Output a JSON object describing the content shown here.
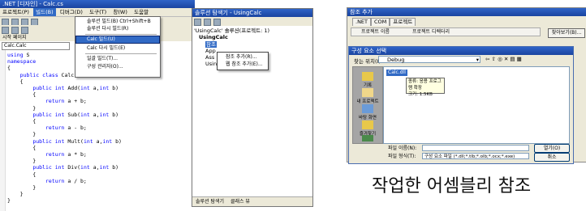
{
  "panel1": {
    "title": ".NET [디자인] - Calc.cs",
    "menu": [
      "프로젝트(P)",
      "빌드(B)",
      "디버그(D)",
      "도구(T)",
      "창(W)",
      "도움말"
    ],
    "selected_menu_index": 1,
    "tab_label": "시작 페이지",
    "combo_value": "Calc.Calc",
    "build_menu": [
      "솔루션 빌드(B)  Ctrl+Shift+B",
      "솔루션 다시 빌드(R)",
      "Calc 빌드(U)",
      "Calc 다시 빌드(E)",
      "일괄 빌드(T)...",
      "구성 관리자(O)..."
    ],
    "selected_build_item": 2,
    "code_lines": [
      "using S",
      "namespace",
      "{",
      "    public class Calc",
      "    {",
      "        public int Add(int a,int b)",
      "        {",
      "            return a + b;",
      "        }",
      "        public int Sub(int a,int b)",
      "        {",
      "            return a - b;",
      "        }",
      "        public int Mult(int a,int b)",
      "        {",
      "            return a * b;",
      "        }",
      "        public int Div(int a,int b)",
      "        {",
      "            return a / b;",
      "        }",
      "    }",
      "}"
    ]
  },
  "panel2": {
    "title": "솔루션 탐색기 - UsingCalc",
    "solution_node": "'UsingCalc' 솔루션(프로젝트: 1)",
    "project_node": "UsingCalc",
    "child_nodes": [
      "참조",
      "App",
      "Ass",
      "UsingCalc.cs"
    ],
    "context_menu": [
      "참조 추가(R)...",
      "웹 참조 추가(E)..."
    ],
    "bottom_tabs": [
      "솔루션 탐색기",
      "클래스 뷰"
    ]
  },
  "panel3": {
    "title": "참조 추가",
    "tabs": [
      ".NET",
      "COM",
      "프로젝트"
    ],
    "columns": [
      "프로젝트 이름",
      "프로젝트 디렉터리"
    ],
    "browse_label": "찾아보기(B)..."
  },
  "panel4": {
    "title": "구성 요소 선택",
    "look_in_label": "찾는 위치(I):",
    "look_in_value": "Debug",
    "places": [
      "기록",
      "내 프로젝트",
      "바탕 화면",
      "즐겨찾기",
      ""
    ],
    "selected_file": "Calc.dll",
    "tooltip_lines": [
      "종류: 응용 프로그램 확장",
      "크기: 1.5KB"
    ],
    "file_name_label": "파일 이름(N):",
    "file_name_value": "",
    "file_type_label": "파일 형식(T):",
    "file_type_value": "구성 요소 파일 (*.dll;*.tlb;*.olb;*.ocx;*.exe)",
    "open_button": "열기(O)",
    "cancel_button": "취소"
  },
  "caption": "작업한 어셈블리 참조"
}
